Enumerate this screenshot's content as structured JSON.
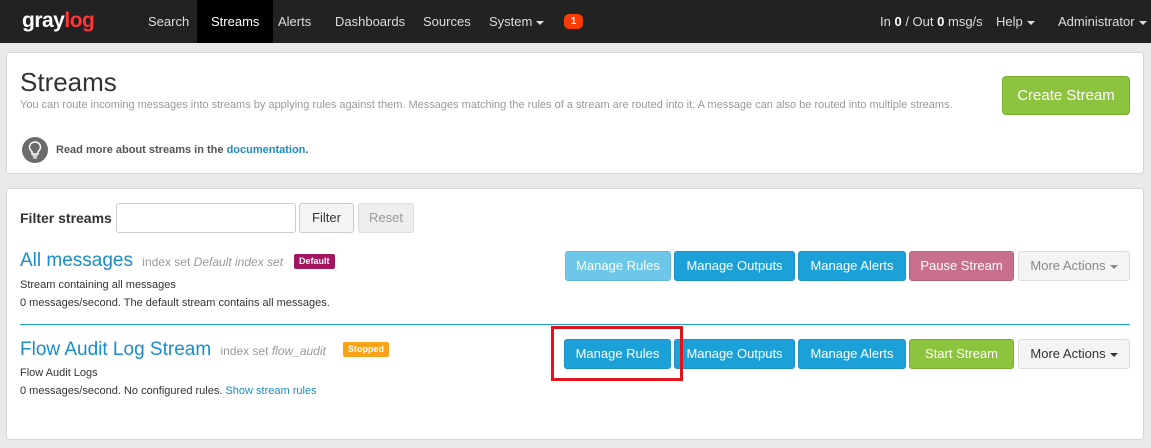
{
  "brand": {
    "part1": "gray",
    "part2": "log"
  },
  "nav": {
    "search": "Search",
    "streams": "Streams",
    "alerts": "Alerts",
    "dashboards": "Dashboards",
    "sources": "Sources",
    "system": "System",
    "notification_count": "1",
    "throughput_in_label": "In",
    "throughput_in": "0",
    "throughput_out_label": "/ Out",
    "throughput_out": "0",
    "throughput_unit": "msg/s",
    "help": "Help",
    "user": "Administrator"
  },
  "header": {
    "title": "Streams",
    "description": "You can route incoming messages into streams by applying rules against them. Messages matching the rules of a stream are routed into it. A message can also be routed into multiple streams.",
    "doc_prefix": "Read more about streams in the",
    "doc_link": "documentation",
    "doc_suffix": ".",
    "create_button": "Create Stream"
  },
  "filter": {
    "label": "Filter streams",
    "value": "",
    "filter_button": "Filter",
    "reset_button": "Reset"
  },
  "streams": [
    {
      "title": "All messages",
      "index_set_label": "index set",
      "index_set": "Default index set",
      "badge": "Default",
      "description": "Stream containing all messages",
      "status_line": "0 messages/second. The default stream contains all messages.",
      "actions": {
        "manage_rules": "Manage Rules",
        "manage_outputs": "Manage Outputs",
        "manage_alerts": "Manage Alerts",
        "toggle": "Pause Stream",
        "more": "More Actions"
      }
    },
    {
      "title": "Flow Audit Log Stream",
      "index_set_label": "index set",
      "index_set": "flow_audit",
      "badge": "Stopped",
      "description": "Flow Audit Logs",
      "status_line": "0 messages/second. No configured rules.",
      "show_rules_link": "Show stream rules",
      "actions": {
        "manage_rules": "Manage Rules",
        "manage_outputs": "Manage Outputs",
        "manage_alerts": "Manage Alerts",
        "toggle": "Start Stream",
        "more": "More Actions"
      }
    }
  ],
  "colors": {
    "navbar": "#222222",
    "brand_accent": "#ff3633",
    "link": "#1a8cc9",
    "info_button": "#1ba0d8",
    "success_button": "#8cc33f",
    "pause_button": "#c76f8d",
    "default_badge": "#a3155f",
    "stopped_badge": "#f8a21a",
    "highlight": "#e0141e"
  },
  "icons": {
    "doc_hint": "lightbulb-icon",
    "dropdown": "caret-down-icon"
  }
}
